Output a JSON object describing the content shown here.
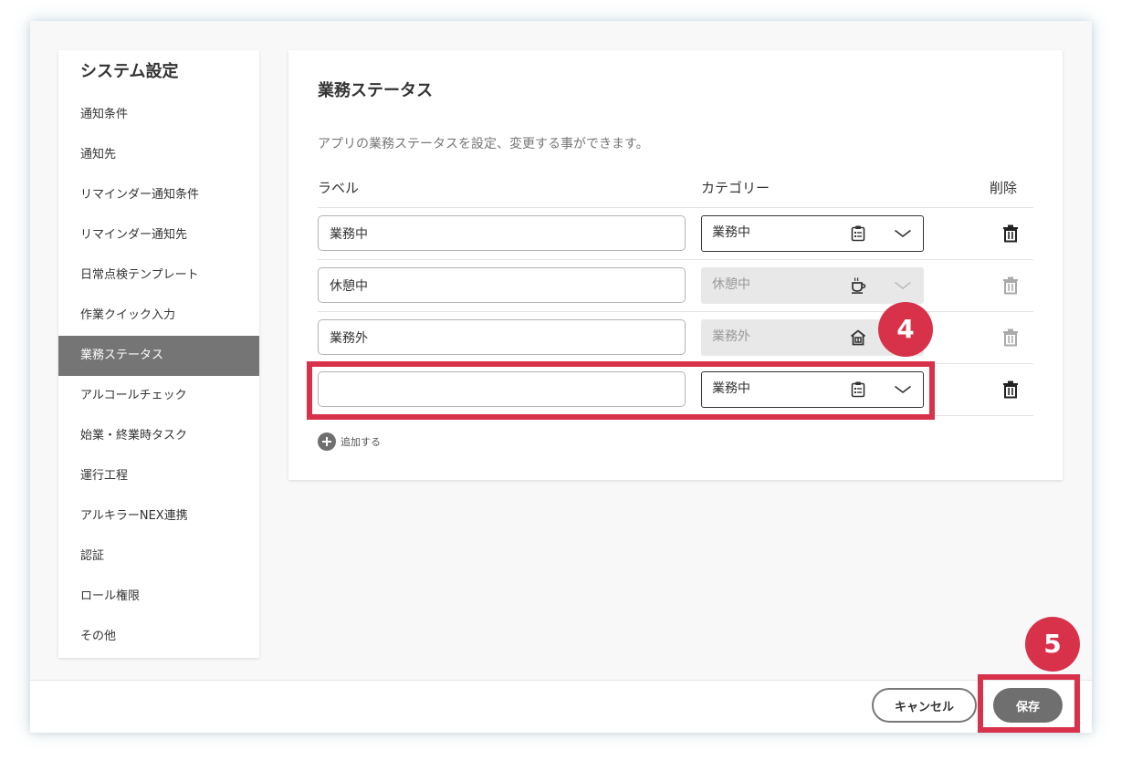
{
  "sidebar": {
    "title": "システム設定",
    "active_index": 6,
    "items": [
      {
        "label": "通知条件"
      },
      {
        "label": "通知先"
      },
      {
        "label": "リマインダー通知条件"
      },
      {
        "label": "リマインダー通知先"
      },
      {
        "label": "日常点検テンプレート"
      },
      {
        "label": "作業クイック入力"
      },
      {
        "label": "業務ステータス"
      },
      {
        "label": "アルコールチェック"
      },
      {
        "label": "始業・終業時タスク"
      },
      {
        "label": "運行工程"
      },
      {
        "label": "アルキラーNEX連携"
      },
      {
        "label": "認証"
      },
      {
        "label": "ロール権限"
      },
      {
        "label": "その他"
      }
    ]
  },
  "main": {
    "title": "業務ステータス",
    "description": "アプリの業務ステータスを設定、変更する事ができます。",
    "columns": {
      "label": "ラベル",
      "category": "カテゴリー",
      "delete": "削除"
    },
    "rows": [
      {
        "label_value": "業務中",
        "category": "業務中",
        "category_icon": "clipboard-icon",
        "enabled": true
      },
      {
        "label_value": "休憩中",
        "category": "休憩中",
        "category_icon": "coffee-cup-icon",
        "enabled": false
      },
      {
        "label_value": "業務外",
        "category": "業務外",
        "category_icon": "house-icon",
        "enabled": false
      },
      {
        "label_value": "",
        "category": "業務中",
        "category_icon": "clipboard-icon",
        "enabled": true
      }
    ],
    "add_label": "追加する"
  },
  "footer": {
    "cancel_label": "キャンセル",
    "save_label": "保存"
  },
  "annotations": {
    "badge_4": "4",
    "badge_5": "5",
    "highlight_color": "#d8314a"
  }
}
